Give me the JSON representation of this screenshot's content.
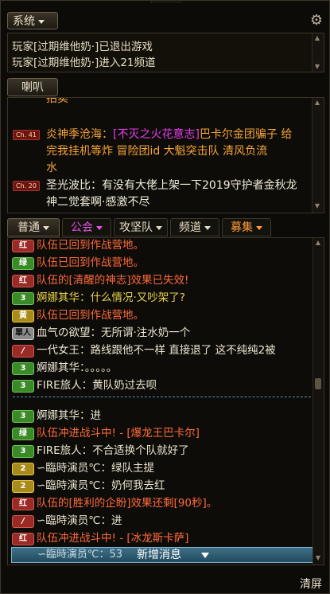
{
  "system": {
    "tab_label": "系统",
    "lines": [
      "玩家[过期维他奶·]已退出游戏",
      "玩家[过期维他奶·]进入21频道"
    ]
  },
  "horn": {
    "tab_label": "喇叭",
    "partial_top": "拍卖",
    "msg1": {
      "channel": "Ch. 41",
      "sender": "炎神季沧海",
      "colon": "：",
      "guild": "[不灭之火花意志]",
      "line1_rest": "巴卡尔金团骗子 给",
      "line2": "完我挂机等炸 冒险团id  大魁突击队  清风负流",
      "line3": "水"
    },
    "msg2": {
      "channel": "Ch. 20",
      "line1": "圣光波比：有没有大佬上架一下2019守护者金秋龙",
      "line2": "神二觉套啊·感激不尽"
    }
  },
  "tabs": [
    {
      "label": "普通"
    },
    {
      "label": "公会"
    },
    {
      "label": "攻坚队"
    },
    {
      "label": "频道"
    },
    {
      "label": "募集"
    }
  ],
  "chat": {
    "rows": [
      {
        "badge": "红",
        "text": "队伍已回到作战营地。"
      },
      {
        "badge": "绿",
        "text": "队伍已回到作战营地。"
      },
      {
        "badge": "红",
        "text": "队伍的[清醒的神志]效果已失效!"
      },
      {
        "badge": "3",
        "text": "婀娜其华：什么情况·又吵架了?"
      },
      {
        "badge": "黄",
        "text": "队伍已回到作战营地。"
      },
      {
        "badge": "單人",
        "text": "血气の欲望：无所谓·注水奶一个"
      },
      {
        "badge": "/",
        "text": "一代女王：路线跟他不一样 直接退了 这不纯纯2被"
      },
      {
        "badge": "3",
        "text": "婀娜其华：。。。。。"
      },
      {
        "badge": "3",
        "text": "FIRE旅人：黄队奶过去呗"
      },
      {
        "badge": "3",
        "text": "婀娜其华：进"
      },
      {
        "badge": "绿",
        "text": "队伍冲进战斗中! - [爆龙王巴卡尔]"
      },
      {
        "badge": "3",
        "text": "FIRE旅人：不合适换个队就好了"
      },
      {
        "badge": "2",
        "text": "∽臨時演员℃：绿队主提"
      },
      {
        "badge": "2",
        "text": "∽臨時演员℃：奶何我去红"
      },
      {
        "badge": "红",
        "text": "队伍的[胜利的企盼]效果还剩[90秒]。"
      },
      {
        "badge": "/",
        "text": "∽臨時演员℃：进"
      },
      {
        "badge": "红",
        "text": "队伍冲进战斗中! - [冰龙斯卡萨]"
      }
    ],
    "partial_last": "∽臨時演员℃：53",
    "new_message_label": "新增消息"
  },
  "footer": {
    "clear_label": "清屏"
  },
  "colors": {
    "background": "#0c0b08",
    "red_team": "#ff6a3a",
    "green_team": "#6fe05a",
    "yellow": "#e8d24a",
    "guild_magenta": "#e33ee8",
    "sender_orange": "#f7a437",
    "divider_blue": "#5b8fb0"
  }
}
